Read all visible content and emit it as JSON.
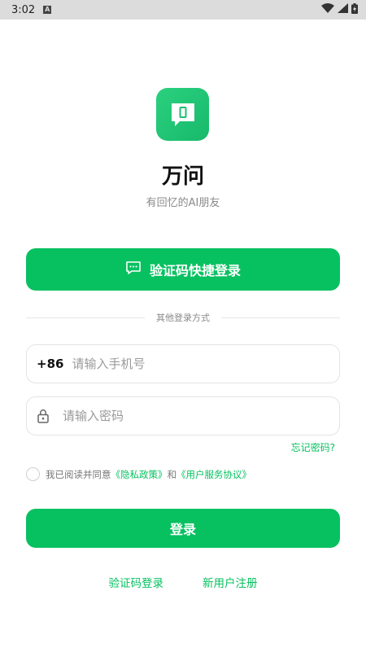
{
  "status_bar": {
    "time": "3:02",
    "notif": "A"
  },
  "app": {
    "name": "万问",
    "slogan": "有回忆的AI朋友"
  },
  "sms_login": {
    "label": "验证码快捷登录"
  },
  "divider": {
    "text": "其他登录方式"
  },
  "phone": {
    "prefix": "+86",
    "placeholder": "请输入手机号"
  },
  "password": {
    "placeholder": "请输入密码"
  },
  "forgot": {
    "label": "忘记密码?"
  },
  "agreement": {
    "text": "我已阅读并同意",
    "privacy": "《隐私政策》",
    "and": "和",
    "terms": "《用户服务协议》"
  },
  "login": {
    "label": "登录"
  },
  "links": {
    "sms": "验证码登录",
    "register": "新用户注册"
  },
  "colors": {
    "accent": "#07c160",
    "status_bar": "#dcdcdc"
  }
}
